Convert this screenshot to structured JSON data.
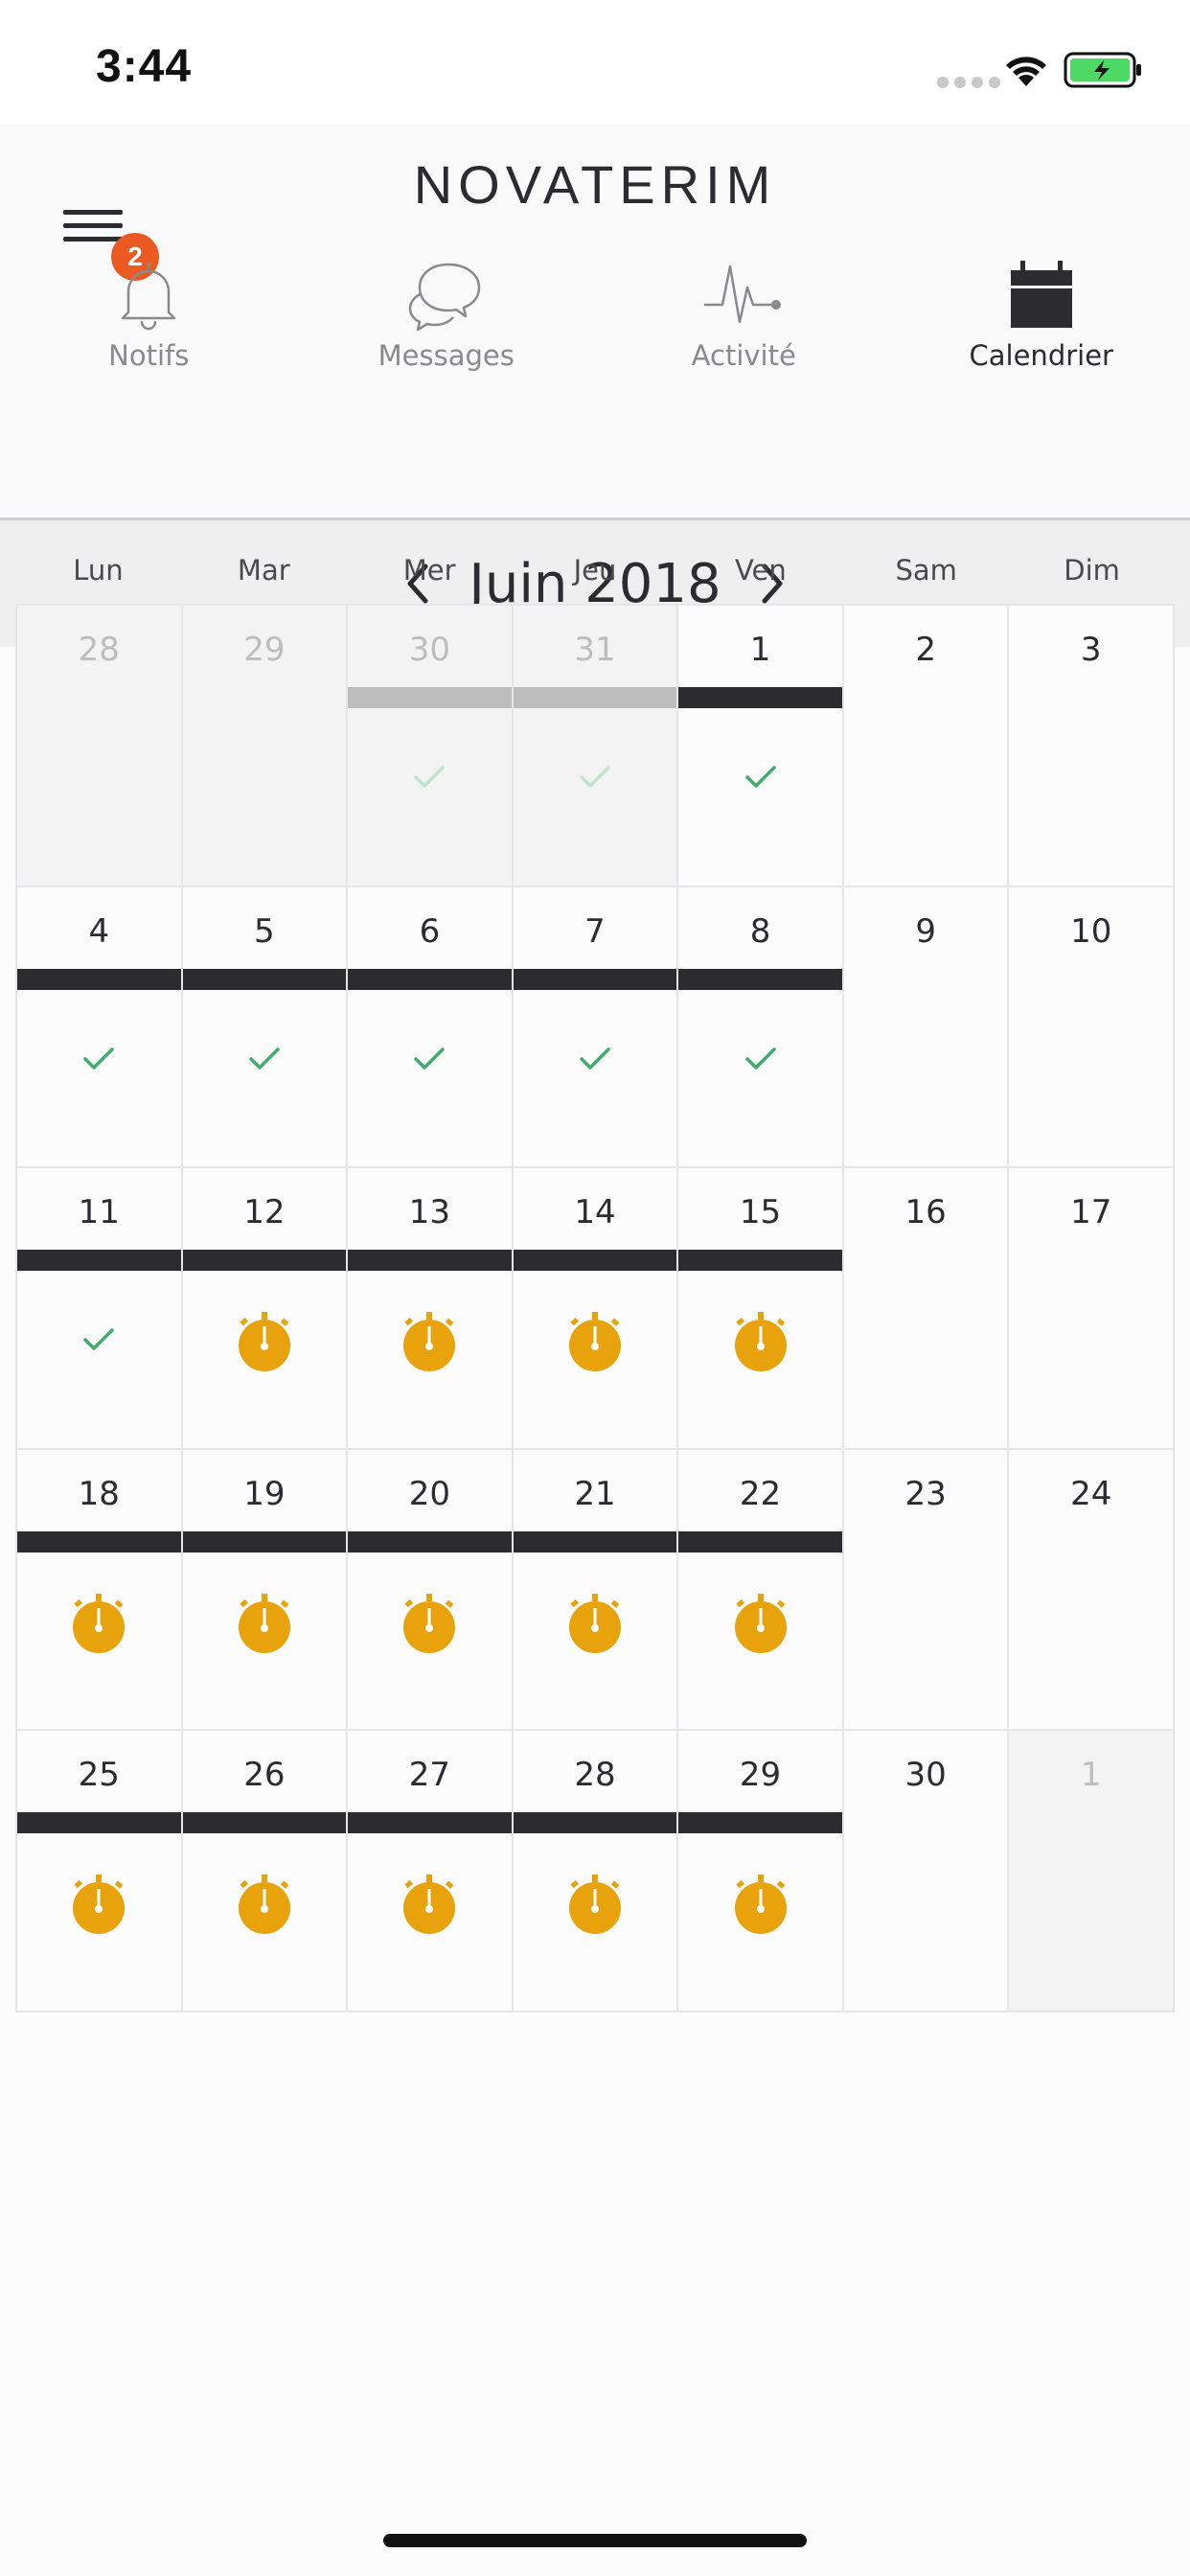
{
  "status_bar": {
    "time": "3:44"
  },
  "header": {
    "logo": "NOVATERIM",
    "menu_badge_count": "2",
    "badge_color": "#ec5a24"
  },
  "tabs": [
    {
      "label": "Notifs",
      "icon": "bell-icon",
      "active": false
    },
    {
      "label": "Messages",
      "icon": "chat-bubbles-icon",
      "active": false
    },
    {
      "label": "Activité",
      "icon": "heartbeat-icon",
      "active": false
    },
    {
      "label": "Calendrier",
      "icon": "calendar-icon",
      "active": true
    }
  ],
  "calendar": {
    "month_title": "Juin 2018",
    "weekdays": [
      "Lun",
      "Mar",
      "Mer",
      "Jeu",
      "Ven",
      "Sam",
      "Dim"
    ],
    "colors": {
      "check": "#3fae6a",
      "check_faded": "#bfe6cc",
      "timer": "#e8a30c",
      "bar": "#2c2c30",
      "bar_gray": "#bdbdbd"
    },
    "days": [
      {
        "day": "28",
        "outside": true,
        "bar": "none",
        "status": "none"
      },
      {
        "day": "29",
        "outside": true,
        "bar": "none",
        "status": "none"
      },
      {
        "day": "30",
        "outside": true,
        "bar": "gray",
        "status": "check-faded"
      },
      {
        "day": "31",
        "outside": true,
        "bar": "gray",
        "status": "check-faded"
      },
      {
        "day": "1",
        "outside": false,
        "bar": "dark",
        "status": "check"
      },
      {
        "day": "2",
        "outside": false,
        "bar": "none",
        "status": "none"
      },
      {
        "day": "3",
        "outside": false,
        "bar": "none",
        "status": "none"
      },
      {
        "day": "4",
        "outside": false,
        "bar": "dark",
        "status": "check"
      },
      {
        "day": "5",
        "outside": false,
        "bar": "dark",
        "status": "check"
      },
      {
        "day": "6",
        "outside": false,
        "bar": "dark",
        "status": "check"
      },
      {
        "day": "7",
        "outside": false,
        "bar": "dark",
        "status": "check"
      },
      {
        "day": "8",
        "outside": false,
        "bar": "dark",
        "status": "check"
      },
      {
        "day": "9",
        "outside": false,
        "bar": "none",
        "status": "none"
      },
      {
        "day": "10",
        "outside": false,
        "bar": "none",
        "status": "none"
      },
      {
        "day": "11",
        "outside": false,
        "bar": "dark",
        "status": "check"
      },
      {
        "day": "12",
        "outside": false,
        "bar": "dark",
        "status": "timer"
      },
      {
        "day": "13",
        "outside": false,
        "bar": "dark",
        "status": "timer"
      },
      {
        "day": "14",
        "outside": false,
        "bar": "dark",
        "status": "timer"
      },
      {
        "day": "15",
        "outside": false,
        "bar": "dark",
        "status": "timer"
      },
      {
        "day": "16",
        "outside": false,
        "bar": "none",
        "status": "none"
      },
      {
        "day": "17",
        "outside": false,
        "bar": "none",
        "status": "none"
      },
      {
        "day": "18",
        "outside": false,
        "bar": "dark",
        "status": "timer"
      },
      {
        "day": "19",
        "outside": false,
        "bar": "dark",
        "status": "timer"
      },
      {
        "day": "20",
        "outside": false,
        "bar": "dark",
        "status": "timer"
      },
      {
        "day": "21",
        "outside": false,
        "bar": "dark",
        "status": "timer"
      },
      {
        "day": "22",
        "outside": false,
        "bar": "dark",
        "status": "timer"
      },
      {
        "day": "23",
        "outside": false,
        "bar": "none",
        "status": "none"
      },
      {
        "day": "24",
        "outside": false,
        "bar": "none",
        "status": "none"
      },
      {
        "day": "25",
        "outside": false,
        "bar": "dark",
        "status": "timer"
      },
      {
        "day": "26",
        "outside": false,
        "bar": "dark",
        "status": "timer"
      },
      {
        "day": "27",
        "outside": false,
        "bar": "dark",
        "status": "timer"
      },
      {
        "day": "28",
        "outside": false,
        "bar": "dark",
        "status": "timer"
      },
      {
        "day": "29",
        "outside": false,
        "bar": "dark",
        "status": "timer"
      },
      {
        "day": "30",
        "outside": false,
        "bar": "none",
        "status": "none"
      },
      {
        "day": "1",
        "outside": true,
        "bar": "none",
        "status": "none"
      }
    ]
  }
}
